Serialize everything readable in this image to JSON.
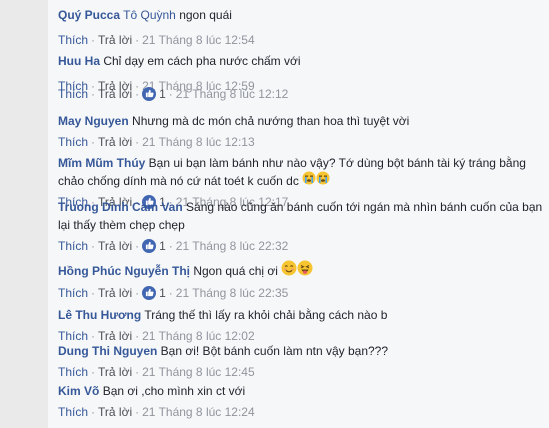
{
  "comments": [
    {
      "name": "Quý Pucca",
      "tag": "Tô Quỳnh",
      "text": "ngon quái",
      "like": "Thích",
      "reply": "Trả lời",
      "time": "21 Tháng 8 lúc 12:54"
    },
    {
      "name": "Huu Ha",
      "text": "Chỉ dạy em cách pha nước chấm với",
      "like": "Thích",
      "reply": "Trả lời",
      "time": "21 Tháng 8 lúc 12:59"
    },
    {
      "name": "",
      "text": "",
      "like": "Thích",
      "reply": "Trả lời",
      "reactions": "1",
      "time": "21 Tháng 8 lúc 12:12"
    },
    {
      "name": "May Nguyen",
      "text": "Nhưng mà dc món chả nướng than hoa thì tuyệt vời",
      "like": "Thích",
      "reply": "Trả lời",
      "time": "21 Tháng 8 lúc 12:13"
    },
    {
      "name": "Mĩm Mũm Thúy",
      "text": "Bạn ui bạn làm bánh như nào vậy? Tớ dùng bột bánh tài ký tráng bằng chảo chống dính mà nó cứ nát toét k cuốn dc",
      "like": "Thích",
      "reply": "Trả lời",
      "reactions": "1",
      "time": "21 Tháng 8 lúc 12:17"
    },
    {
      "name": "Truong Dinh Cam Van",
      "text": "Sáng nào cũng ăn bánh cuốn tới ngán mà nhìn bánh cuốn của bạn lại thấy thèm chẹp chẹp",
      "like": "Thích",
      "reply": "Trả lời",
      "reactions": "1",
      "time": "21 Tháng 8 lúc 22:32"
    },
    {
      "name": "Hồng Phúc Nguyễn Thị",
      "text": "Ngon quá chị ơi",
      "like": "Thích",
      "reply": "Trả lời",
      "reactions": "1",
      "time": "21 Tháng 8 lúc 22:35"
    },
    {
      "name": "Lê Thu Hương",
      "text": "Tráng thế thì lấy ra khỏi chải bằng cách nào b",
      "like": "Thích",
      "reply": "Trả lời",
      "time": "21 Tháng 8 lúc 12:02"
    },
    {
      "name": "Dung Thi Nguyen",
      "text": "Bạn ơi! Bột bánh cuốn làm ntn vậy bạn???",
      "like": "Thích",
      "reply": "Trả lời",
      "time": "21 Tháng 8 lúc 12:45"
    },
    {
      "name": "Kim Võ",
      "text": "Bạn ơi ,cho mình xin ct với",
      "like": "Thích",
      "reply": "Trả lời",
      "time": "21 Tháng 8 lúc 12:24"
    }
  ],
  "colors": {
    "name": "#365899",
    "meta": "#90949c",
    "like": "#4267b2"
  },
  "icons": {
    "reaction": "thumbs-up-icon",
    "crying": "crying-emoji-icon",
    "smile": "smile-emoji-icon",
    "tongue": "tongue-emoji-icon"
  }
}
